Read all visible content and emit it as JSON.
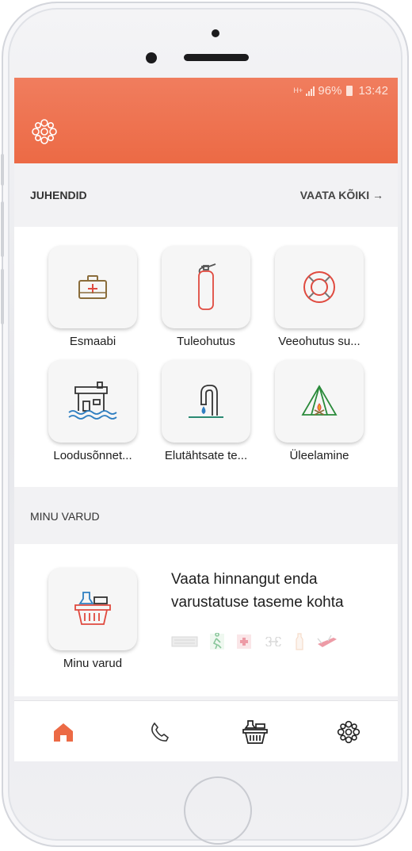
{
  "status_bar": {
    "network": "H+",
    "battery": "96%",
    "time": "13:42"
  },
  "colors": {
    "accent": "#ec6a45",
    "app_bar_top": "#f07d5e",
    "background": "#f2f2f4"
  },
  "guides_section": {
    "title": "JUHENDID",
    "see_all": "VAATA KÕIKI →",
    "items": [
      {
        "label": "Esmaabi",
        "icon": "first-aid-kit-icon"
      },
      {
        "label": "Tuleohutus",
        "icon": "fire-extinguisher-icon"
      },
      {
        "label": "Veeohutus su...",
        "icon": "lifebuoy-icon"
      },
      {
        "label": "Loodusõnnet...",
        "icon": "flooded-house-icon"
      },
      {
        "label": "Elutähtsate te...",
        "icon": "water-tap-icon"
      },
      {
        "label": "Üleelamine",
        "icon": "tent-campfire-icon"
      }
    ]
  },
  "supplies_section": {
    "title": "MINU VARUD",
    "tile_label": "Minu varud",
    "tile_icon": "supply-basket-icon",
    "description": "Vaata hinnangut enda varustatuse taseme kohta",
    "mini_icons": [
      "keyboard-icon",
      "exit-sign-icon",
      "first-aid-icon",
      "bone-icon",
      "bottle-icon",
      "pocket-knife-icon"
    ]
  },
  "bottom_nav": [
    {
      "name": "home",
      "icon": "home-icon",
      "active": true
    },
    {
      "name": "phone",
      "icon": "phone-icon",
      "active": false
    },
    {
      "name": "supplies",
      "icon": "basket-icon",
      "active": false
    },
    {
      "name": "about",
      "icon": "logo-icon",
      "active": false
    }
  ]
}
